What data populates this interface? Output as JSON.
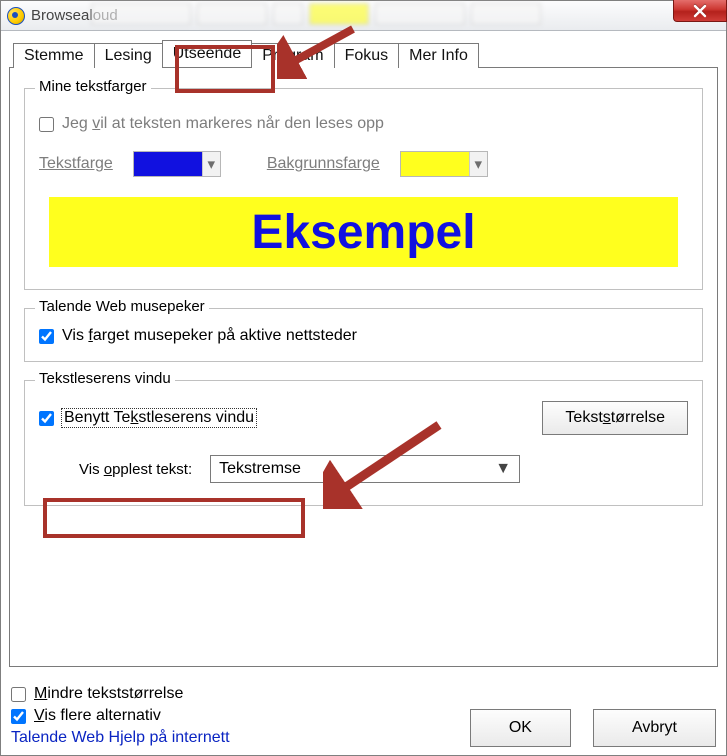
{
  "window": {
    "title": "Browsealoud"
  },
  "tabs": {
    "stemme": "Stemme",
    "lesing": "Lesing",
    "utseende": "Utseende",
    "program": "Program",
    "fokus": "Fokus",
    "merinfo": "Mer Info",
    "selected": "utseende"
  },
  "colors": {
    "text_color": "#1111e0",
    "bg_color": "#ffff1e"
  },
  "group_colors": {
    "legend": "Mine tekstfarger",
    "chk_label_pre": "Jeg ",
    "chk_label_u": "v",
    "chk_label_post": "il at teksten markeres når den leses opp",
    "text_color_label": "Tekstfarge",
    "bg_color_label": "Bakgrunnsfarge",
    "example_text": "Eksempel"
  },
  "group_mouse": {
    "legend": "Talende Web musepeker",
    "chk_label_pre": "Vis ",
    "chk_label_u": "f",
    "chk_label_post": "arget musepeker på aktive nettsteder",
    "checked": true
  },
  "group_reader": {
    "legend": "Tekstleserens vindu",
    "chk_label_pre": "Benytt Te",
    "chk_label_u": "k",
    "chk_label_post": "stleserens vindu",
    "checked": true,
    "size_btn_pre": "Tekst",
    "size_btn_u": "s",
    "size_btn_post": "tørrelse",
    "vis_label_pre": "Vis ",
    "vis_label_u": "o",
    "vis_label_post": "pplest tekst:",
    "select_value": "Tekstremse"
  },
  "footer": {
    "chk_small_pre": "",
    "chk_small_u": "M",
    "chk_small_post": "indre tekststørrelse",
    "chk_small_checked": false,
    "chk_more_pre": "",
    "chk_more_u": "V",
    "chk_more_post": "is flere alternativ",
    "chk_more_checked": true,
    "link_text": "Talende Web Hjelp på internett",
    "ok": "OK",
    "cancel": "Avbryt"
  }
}
